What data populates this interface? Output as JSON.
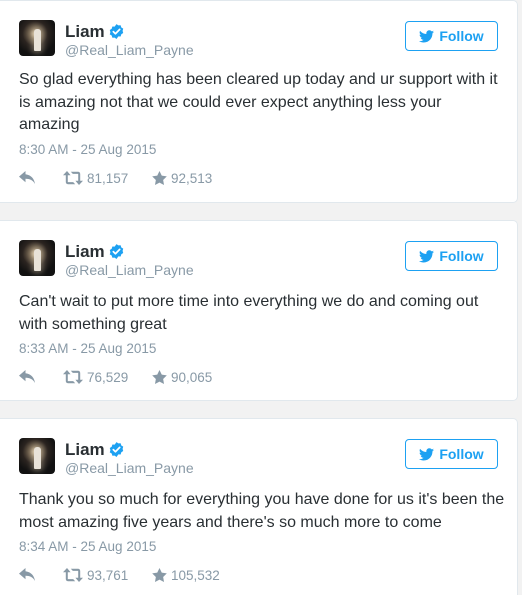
{
  "colors": {
    "accent": "#1da1f2",
    "verified": "#1da1f2",
    "secondary_text": "#8899a6",
    "primary_text": "#292f33"
  },
  "icons": {
    "reply": "reply-icon",
    "retweet": "retweet-icon",
    "like": "star-icon",
    "verified": "verified-badge-icon",
    "follow": "twitter-bird-icon"
  },
  "tweets": [
    {
      "name": "Liam",
      "handle": "@Real_Liam_Payne",
      "follow_label": "Follow",
      "text": "So glad everything has been cleared up today and ur support with it is amazing not that we could ever expect anything less your amazing",
      "timestamp": "8:30 AM - 25 Aug 2015",
      "retweets": "81,157",
      "likes": "92,513"
    },
    {
      "name": "Liam",
      "handle": "@Real_Liam_Payne",
      "follow_label": "Follow",
      "text": "Can't wait to put more time into everything we do and coming out with something great",
      "timestamp": "8:33 AM - 25 Aug 2015",
      "retweets": "76,529",
      "likes": "90,065"
    },
    {
      "name": "Liam",
      "handle": "@Real_Liam_Payne",
      "follow_label": "Follow",
      "text": "Thank you so much for everything you have done for us it's been the most amazing five years and there's so much more to come",
      "timestamp": "8:34 AM - 25 Aug 2015",
      "retweets": "93,761",
      "likes": "105,532"
    }
  ]
}
